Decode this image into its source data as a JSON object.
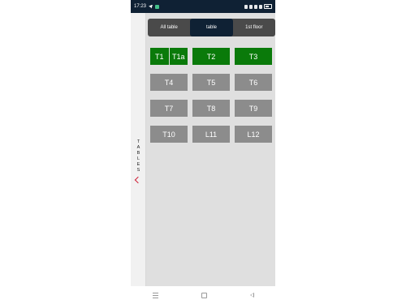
{
  "status_bar": {
    "time": "17:23"
  },
  "drawer": {
    "label_letters": [
      "T",
      "A",
      "B",
      "L",
      "E",
      "S"
    ]
  },
  "tabs": [
    {
      "label": "All table",
      "active": false
    },
    {
      "label": "table",
      "active": true
    },
    {
      "label": "1st floor",
      "active": false
    }
  ],
  "tables": [
    {
      "label": "T1",
      "status": "occupied"
    },
    {
      "label": "T1a",
      "status": "occupied"
    },
    {
      "label": "T2",
      "status": "occupied"
    },
    {
      "label": "T3",
      "status": "occupied"
    },
    {
      "label": "T4",
      "status": "free"
    },
    {
      "label": "T5",
      "status": "free"
    },
    {
      "label": "T6",
      "status": "free"
    },
    {
      "label": "T7",
      "status": "free"
    },
    {
      "label": "T8",
      "status": "free"
    },
    {
      "label": "T9",
      "status": "free"
    },
    {
      "label": "T10",
      "status": "free"
    },
    {
      "label": "L11",
      "status": "free"
    },
    {
      "label": "L12",
      "status": "free"
    }
  ],
  "colors": {
    "occupied": "#0a7a0a",
    "free": "#8c8c8c",
    "active_tab": "#0f2134",
    "tab_bar": "#4a4a4a",
    "accent": "#d0233a"
  },
  "icons": [
    "telegram-icon",
    "app-badge-icon",
    "signal-icon",
    "battery-icon",
    "chevron-left-icon",
    "menu-icon",
    "home-icon",
    "back-icon"
  ]
}
